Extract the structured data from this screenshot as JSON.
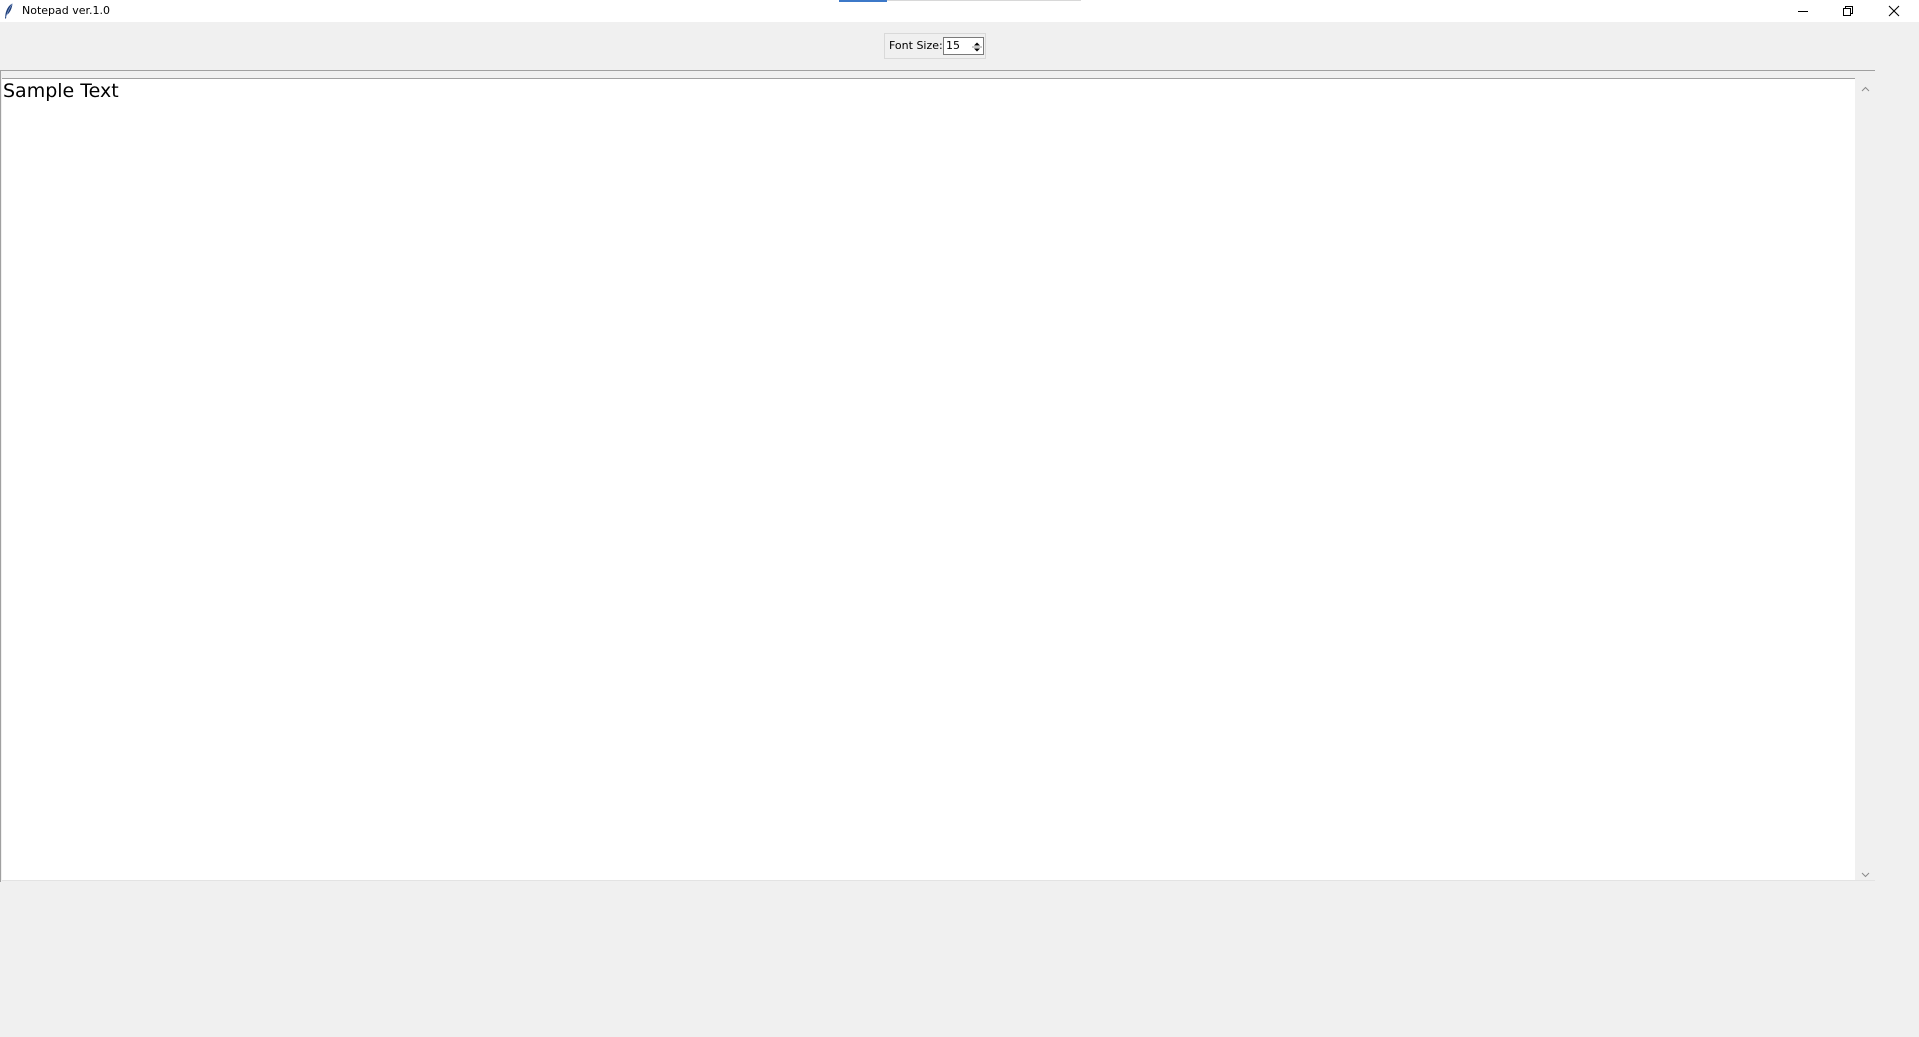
{
  "window": {
    "title": "Notepad ver.1.0",
    "icons": {
      "app": "feather-icon",
      "minimize": "minimize-icon",
      "maximize": "restore-icon",
      "close": "close-icon"
    }
  },
  "toolbar": {
    "font_size_label": "Font Size:",
    "font_size_value": "15",
    "spinner_icons": "spinner-arrows-icon"
  },
  "editor": {
    "content": "Sample Text",
    "scroll_icons": {
      "up": "chevron-up-icon",
      "down": "chevron-down-icon"
    }
  },
  "colors": {
    "window_bg": "#f0f0f0",
    "editor_bg": "#ffffff",
    "accent": "#3c78c8"
  }
}
